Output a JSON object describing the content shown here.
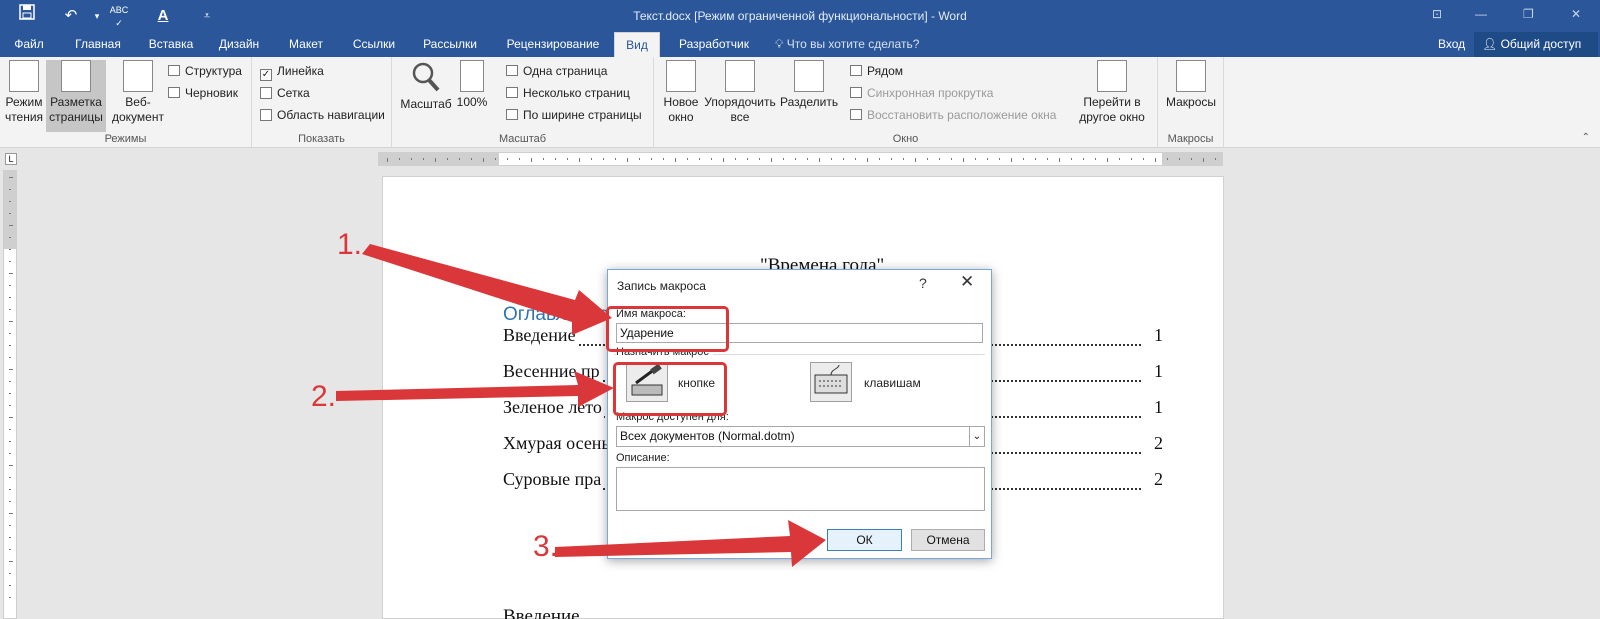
{
  "window": {
    "title": "Текст.docx [Режим ограниченной функциональности] - Word"
  },
  "quick_access": [
    {
      "name": "save-icon",
      "glyph": "🖫"
    },
    {
      "name": "undo-icon",
      "glyph": "↶"
    },
    {
      "name": "spelling-icon",
      "glyph": "✓"
    },
    {
      "name": "font-color-icon",
      "glyph": "A"
    },
    {
      "name": "customize-icon",
      "glyph": "⩡"
    }
  ],
  "tabs": {
    "file": "Файл",
    "home": "Главная",
    "insert": "Вставка",
    "design": "Дизайн",
    "layout": "Макет",
    "references": "Ссылки",
    "mailings": "Рассылки",
    "review": "Рецензирование",
    "view": "Вид",
    "developer": "Разработчик"
  },
  "tell_me": "Что вы хотите сделать?",
  "sign_in": "Вход",
  "share": "Общий доступ",
  "ribbon": {
    "modes": {
      "label": "Режимы",
      "read": "Режим чтения",
      "print_layout": "Разметка страницы",
      "web": "Веб-документ",
      "outline": "Структура",
      "draft": "Черновик"
    },
    "show": {
      "label": "Показать",
      "ruler": "Линейка",
      "gridlines": "Сетка",
      "nav_pane": "Область навигации"
    },
    "zoom": {
      "label": "Масштаб",
      "zoom": "Масштаб",
      "hundred": "100%",
      "one_page": "Одна страница",
      "multi_page": "Несколько страниц",
      "page_width": "По ширине страницы"
    },
    "window": {
      "label": "Окно",
      "new_window": "Новое окно",
      "arrange_all": "Упорядочить все",
      "split": "Разделить",
      "side_by_side": "Рядом",
      "sync_scroll": "Синхронная прокрутка",
      "reset_pos": "Восстановить расположение окна",
      "switch": "Перейти в другое окно"
    },
    "macros": {
      "label": "Макросы",
      "macros": "Макросы"
    }
  },
  "document": {
    "heading": "\"Времена года\"",
    "toc_title": "Оглавление",
    "toc": [
      {
        "text": "Введение",
        "page": "1"
      },
      {
        "text": "Весенние пр",
        "page": "1"
      },
      {
        "text": "Зеленое лето",
        "page": "1"
      },
      {
        "text": "Хмурая осень",
        "page": "2"
      },
      {
        "text": "Суровые пра",
        "page": "2"
      }
    ],
    "intro": "Введение"
  },
  "dialog": {
    "title": "Запись макроса",
    "help": "?",
    "close": "✕",
    "macro_name_label": "Имя макроса:",
    "macro_name_value": "Ударение",
    "assign_label": "Назначить макрос",
    "button_option": "кнопке",
    "keyboard_option": "клавишам",
    "store_label": "Макрос доступен для:",
    "store_value": "Всех документов (Normal.dotm)",
    "description_label": "Описание:",
    "ok": "ОК",
    "cancel": "Отмена"
  },
  "annotations": {
    "step1": "1.",
    "step2": "2.",
    "step3": "3."
  },
  "colors": {
    "title_bar": "#2b579a",
    "accent": "#2b579a",
    "annotation": "#d9373a",
    "toc_heading": "#2e74b5"
  }
}
